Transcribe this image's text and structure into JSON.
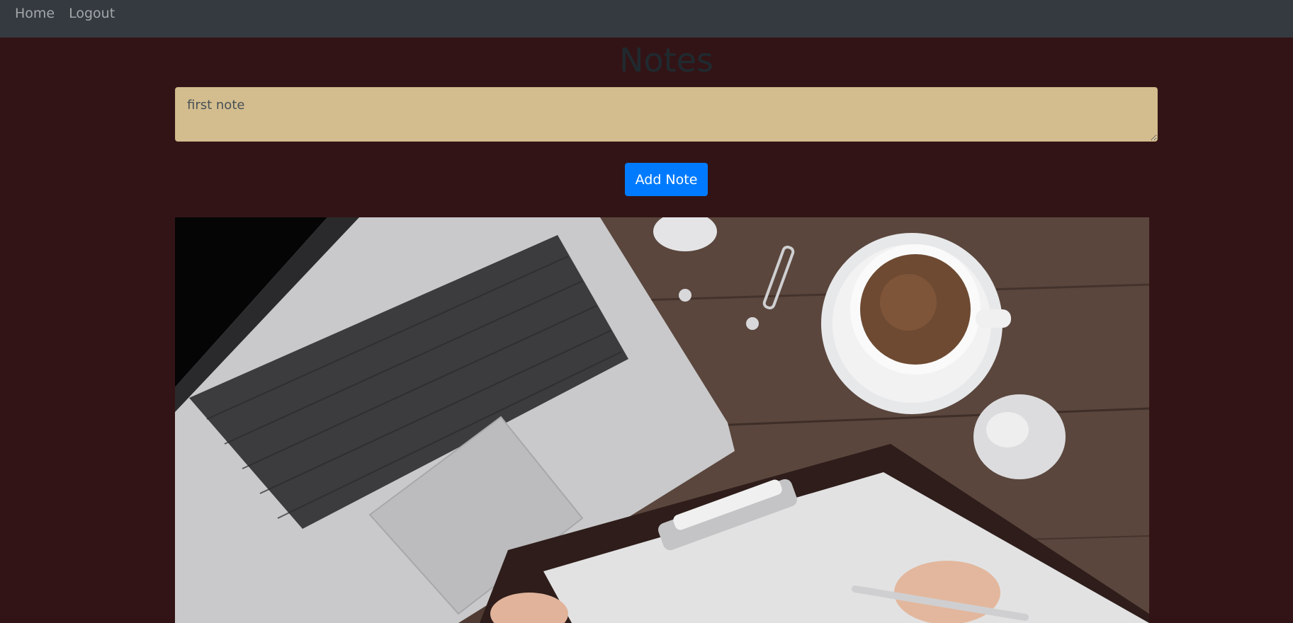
{
  "nav": {
    "home_label": "Home",
    "logout_label": "Logout"
  },
  "page": {
    "title": "Notes"
  },
  "note_input": {
    "placeholder": "first note",
    "value": ""
  },
  "add_button": {
    "label": "Add Note"
  },
  "colors": {
    "background": "#331416",
    "navbar": "#343a40",
    "input_background": "#d3bd8e",
    "button": "#007bff"
  }
}
